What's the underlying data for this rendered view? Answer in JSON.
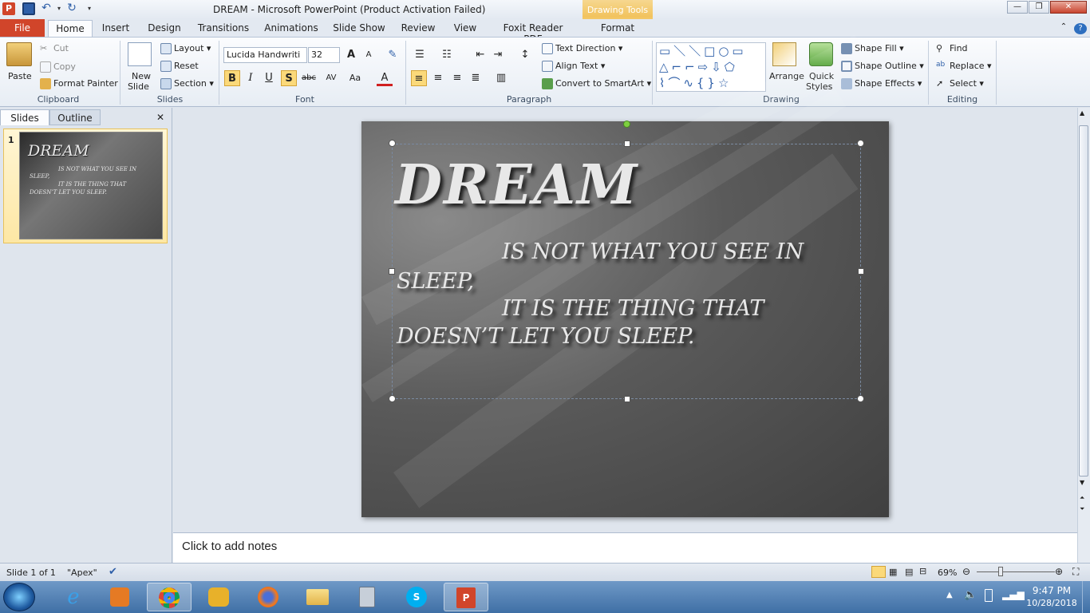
{
  "window": {
    "title": "DREAM  -  Microsoft PowerPoint (Product Activation Failed)",
    "app_icon": "P",
    "minimize": "—",
    "restore": "❐",
    "close": "✕"
  },
  "tabs": {
    "file": "File",
    "home": "Home",
    "insert": "Insert",
    "design": "Design",
    "transitions": "Transitions",
    "animations": "Animations",
    "slideshow": "Slide Show",
    "review": "Review",
    "view": "View",
    "foxit": "Foxit Reader PDF",
    "drawing_tools": "Drawing Tools",
    "format": "Format"
  },
  "clipboard": {
    "paste": "Paste",
    "cut": "Cut",
    "copy": "Copy",
    "format_painter": "Format Painter",
    "label": "Clipboard"
  },
  "slides_grp": {
    "new_slide_1": "New",
    "new_slide_2": "Slide",
    "layout": "Layout",
    "reset": "Reset",
    "section": "Section",
    "label": "Slides"
  },
  "font": {
    "name": "Lucida Handwriti",
    "size": "32",
    "label": "Font",
    "bold": "B",
    "italic": "I",
    "underline": "U",
    "shadow": "S",
    "strike": "abc",
    "spacing": "AV",
    "case": "Aa",
    "color": "A",
    "grow": "A",
    "shrink": "A"
  },
  "paragraph": {
    "label": "Paragraph",
    "text_direction": "Text Direction",
    "align_text": "Align Text",
    "smartart": "Convert to SmartArt"
  },
  "drawing": {
    "label": "Drawing",
    "arrange": "Arrange",
    "quick_1": "Quick",
    "quick_2": "Styles",
    "shape_fill": "Shape Fill",
    "shape_outline": "Shape Outline",
    "shape_effects": "Shape Effects"
  },
  "editing": {
    "label": "Editing",
    "find": "Find",
    "replace": "Replace",
    "select": "Select"
  },
  "left_pane": {
    "slides_tab": "Slides",
    "outline_tab": "Outline",
    "close": "✕",
    "slide_num": "1"
  },
  "thumb": {
    "title": "DREAM",
    "line1": "IS NOT WHAT YOU SEE IN",
    "line2": "SLEEP,",
    "line3": "IT IS THE THING THAT",
    "line4": "DOESN’T LET YOU SLEEP."
  },
  "slide": {
    "title": "DREAM",
    "line1": "IS NOT WHAT YOU SEE IN",
    "line2": "SLEEP,",
    "line3": "IT IS THE THING THAT",
    "line4": "DOESN’T LET YOU SLEEP."
  },
  "notes": {
    "placeholder": "Click to add notes"
  },
  "status": {
    "slide_info": "Slide 1 of 1",
    "theme": "\"Apex\"",
    "zoom": "69%"
  },
  "taskbar": {
    "time": "9:47 PM",
    "date": "10/28/2018"
  },
  "colors": {
    "file_tab": "#d1452a",
    "ribbon_bg": "#e7edf4",
    "taskbar": "#3f6fa5",
    "slide_bg": "#5a5a5a"
  }
}
